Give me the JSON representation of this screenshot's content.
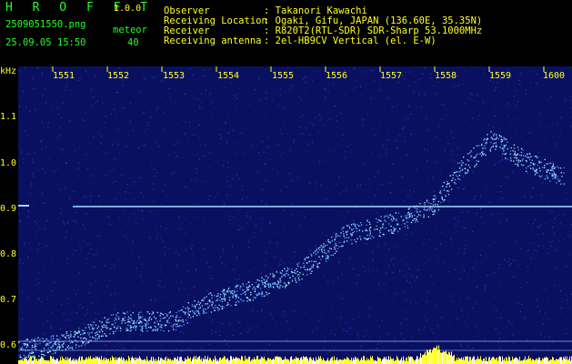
{
  "header": {
    "app_name": "H R O F F T",
    "version": "1.0.0",
    "filename": "2509051550.png",
    "mode_label": "meteor",
    "datetime": "25.09.05 15:50",
    "count": "40",
    "info": [
      {
        "label": "Observer",
        "value": ": Takanori Kawachi"
      },
      {
        "label": "Receiving Location",
        "value": ": Ogaki, Gifu, JAPAN (136.60E, 35.35N)"
      },
      {
        "label": "Receiver",
        "value": ": R820T2(RTL-SDR) SDR-Sharp 53.1000MHz"
      },
      {
        "label": "Receiving antenna",
        "value": ": 2el-HB9CV Vertical (el. E-W)"
      }
    ]
  },
  "axes": {
    "y_unit": "kHz",
    "y_ticks": [
      "1.1",
      "1.0",
      "0.9",
      "0.8",
      "0.7",
      "0.6"
    ],
    "x_ticks": [
      "1551",
      "1552",
      "1553",
      "1554",
      "1555",
      "1556",
      "1557",
      "1558",
      "1559",
      "1600"
    ]
  },
  "colors": {
    "text_green": "#22ff22",
    "text_yellow": "#ffff22",
    "background": "#000000",
    "waterfall_bg": "#0a1060",
    "signal": "#7fd8ff"
  }
}
